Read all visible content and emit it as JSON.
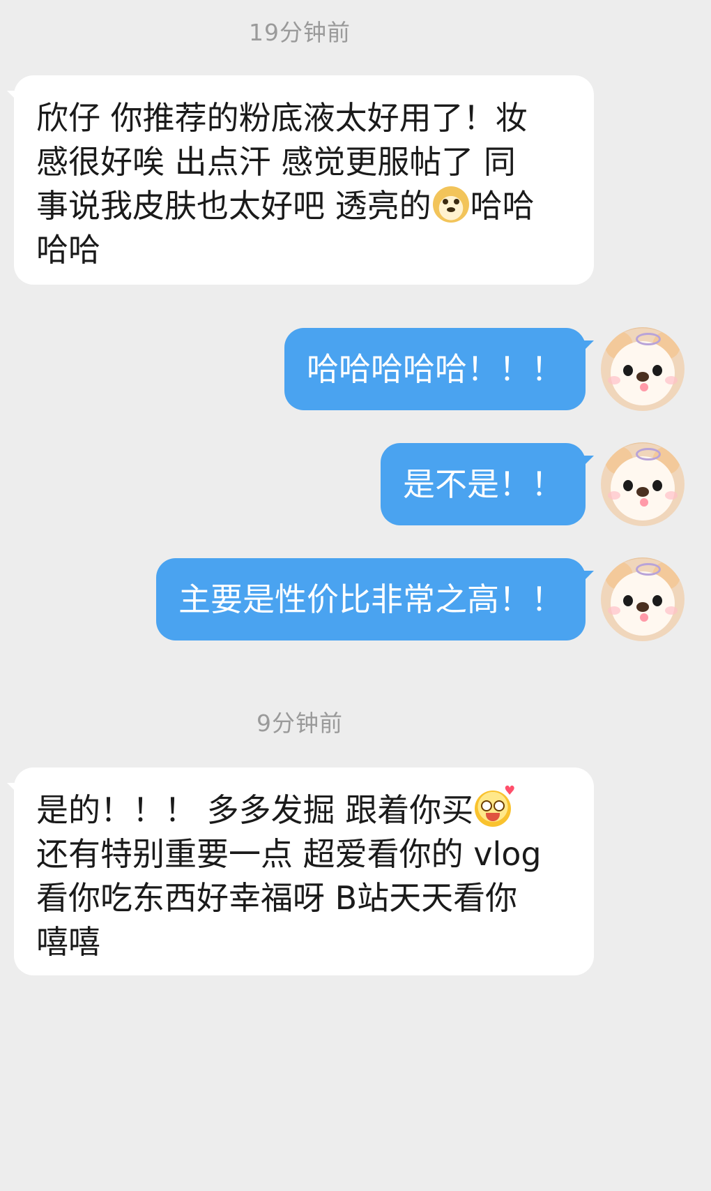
{
  "timestamps": {
    "first": "19分钟前",
    "second": "9分钟前"
  },
  "messages": {
    "incoming_1": {
      "line1": "欣仔 你推荐的粉底液太好用了！妆",
      "line2": "感很好唉 出点汗 感觉更服帖了  同",
      "line3_before_emoji": "事说我皮肤也太好吧 透亮的",
      "line3_emoji": "doge-emoji",
      "line3_after_emoji": "哈哈",
      "line4": "哈哈"
    },
    "outgoing_1": "哈哈哈哈哈！！！",
    "outgoing_2": "是不是！！",
    "outgoing_3": "主要是性价比非常之高！！",
    "incoming_2": {
      "line1_before_emoji": "是的！！！ 多多发掘 跟着你买",
      "line1_emoji": "excited-face-emoji",
      "line2": "还有特别重要一点 超爱看你的 vlog",
      "line3": "看你吃东西好幸福呀 B站天天看你",
      "line4": "嘻嘻"
    }
  },
  "colors": {
    "background": "#ededed",
    "incoming_bubble": "#ffffff",
    "outgoing_bubble": "#4aa3f0",
    "timestamp_text": "#9a9a9a"
  },
  "avatar": {
    "icon": "plush-dog-avatar"
  }
}
